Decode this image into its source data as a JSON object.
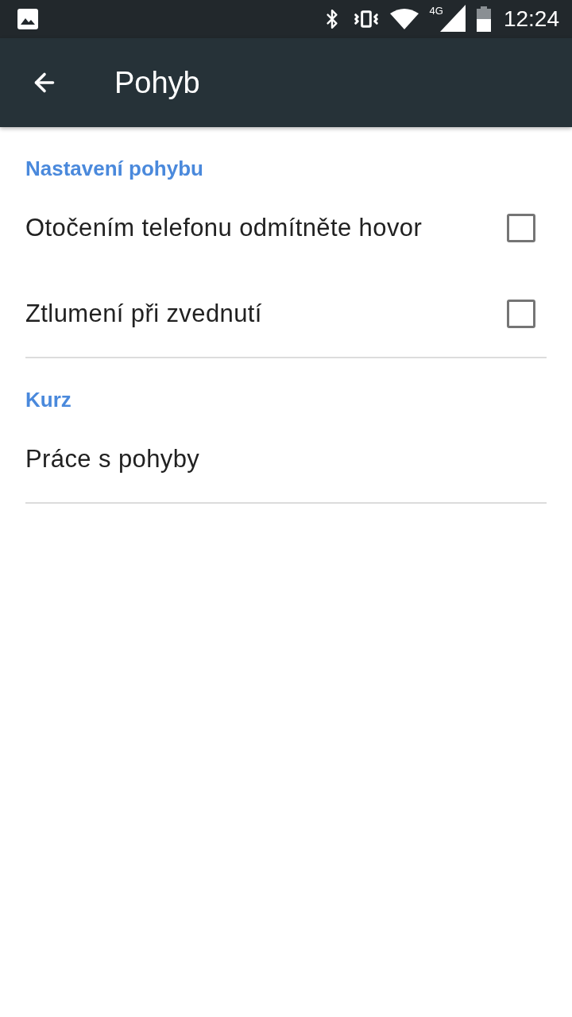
{
  "status_bar": {
    "network": "4G",
    "time": "12:24"
  },
  "app_bar": {
    "title": "Pohyb"
  },
  "sections": [
    {
      "header": "Nastavení pohybu",
      "items": [
        {
          "kind": "checkbox",
          "label": "Otočením telefonu odmítněte hovor",
          "checked": false
        },
        {
          "kind": "checkbox",
          "label": "Ztlumení při zvednutí",
          "checked": false
        }
      ]
    },
    {
      "header": "Kurz",
      "items": [
        {
          "kind": "link",
          "label": "Práce s pohyby"
        }
      ]
    }
  ]
}
